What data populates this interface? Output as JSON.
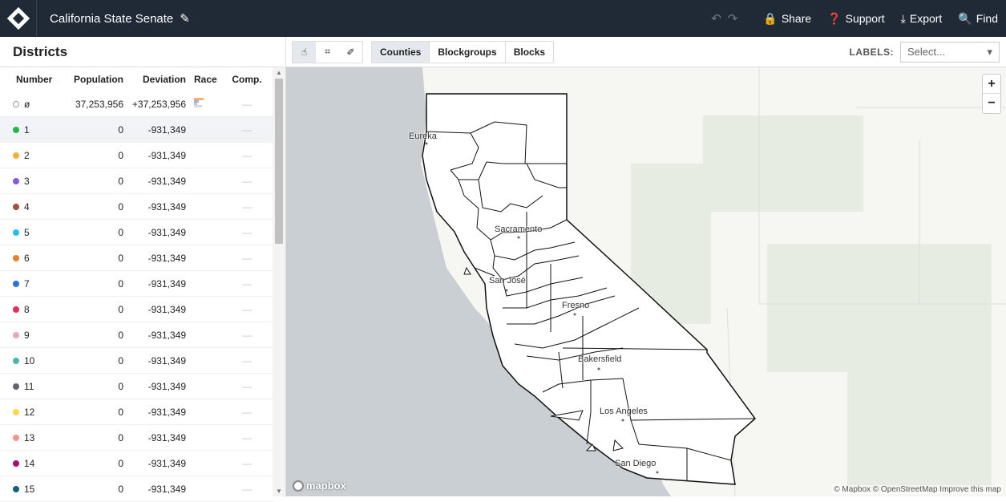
{
  "app": {
    "title": "California State Senate"
  },
  "topbar": {
    "share": "Share",
    "support": "Support",
    "export": "Export",
    "find": "Find"
  },
  "panel": {
    "title": "Districts",
    "columns": [
      "Number",
      "Population",
      "Deviation",
      "Race",
      "Comp."
    ],
    "rows": [
      {
        "number": "ø",
        "population": "37,253,956",
        "deviation": "+37,253,956",
        "comp": "—",
        "color": "#ffffff",
        "race": true
      },
      {
        "number": "1",
        "population": "0",
        "deviation": "-931,349",
        "comp": "—",
        "color": "#1fb84a"
      },
      {
        "number": "2",
        "population": "0",
        "deviation": "-931,349",
        "comp": "—",
        "color": "#f1b134"
      },
      {
        "number": "3",
        "population": "0",
        "deviation": "-931,349",
        "comp": "—",
        "color": "#8a57e0"
      },
      {
        "number": "4",
        "population": "0",
        "deviation": "-931,349",
        "comp": "—",
        "color": "#a0523a"
      },
      {
        "number": "5",
        "population": "0",
        "deviation": "-931,349",
        "comp": "—",
        "color": "#1fc1e8"
      },
      {
        "number": "6",
        "population": "0",
        "deviation": "-931,349",
        "comp": "—",
        "color": "#f07a2a"
      },
      {
        "number": "7",
        "population": "0",
        "deviation": "-931,349",
        "comp": "—",
        "color": "#2b70e4"
      },
      {
        "number": "8",
        "population": "0",
        "deviation": "-931,349",
        "comp": "—",
        "color": "#e62e55"
      },
      {
        "number": "9",
        "population": "0",
        "deviation": "-931,349",
        "comp": "—",
        "color": "#e7a6c3"
      },
      {
        "number": "10",
        "population": "0",
        "deviation": "-931,349",
        "comp": "—",
        "color": "#4bb7a6"
      },
      {
        "number": "11",
        "population": "0",
        "deviation": "-931,349",
        "comp": "—",
        "color": "#676170"
      },
      {
        "number": "12",
        "population": "0",
        "deviation": "-931,349",
        "comp": "—",
        "color": "#f9d94a"
      },
      {
        "number": "13",
        "population": "0",
        "deviation": "-931,349",
        "comp": "—",
        "color": "#f3948a"
      },
      {
        "number": "14",
        "population": "0",
        "deviation": "-931,349",
        "comp": "—",
        "color": "#a0157d"
      },
      {
        "number": "15",
        "population": "0",
        "deviation": "-931,349",
        "comp": "—",
        "color": "#0e6476"
      }
    ]
  },
  "toolbar": {
    "units": [
      "Counties",
      "Blockgroups",
      "Blocks"
    ],
    "labels_label": "LABELS:",
    "labels_placeholder": "Select..."
  },
  "map": {
    "cities": [
      "Eureka",
      "Sacramento",
      "San José",
      "Fresno",
      "Bakersfield",
      "Los Angeles",
      "San Diego"
    ],
    "logo": "mapbox",
    "attribution": "© Mapbox © OpenStreetMap Improve this map",
    "zoom_in": "+",
    "zoom_out": "−"
  }
}
